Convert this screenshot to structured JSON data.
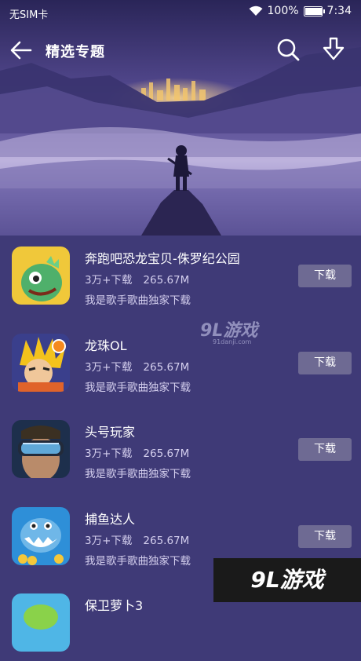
{
  "status_bar": {
    "carrier": "无SIM卡",
    "battery": "100%",
    "battery_level": 1.0,
    "time": "7:34"
  },
  "app_bar": {
    "title": "精选专题"
  },
  "items": [
    {
      "name": "奔跑吧恐龙宝贝-侏罗纪公园",
      "downloads": "3万+下载",
      "size": "265.67M",
      "desc": "我是歌手歌曲独家下载",
      "button": "下载",
      "icon": "dinosaur-game-icon"
    },
    {
      "name": "龙珠OL",
      "downloads": "3万+下载",
      "size": "265.67M",
      "desc": "我是歌手歌曲独家下载",
      "button": "下载",
      "icon": "dragonball-game-icon"
    },
    {
      "name": "头号玩家",
      "downloads": "3万+下载",
      "size": "265.67M",
      "desc": "我是歌手歌曲独家下载",
      "button": "下载",
      "icon": "vr-headset-game-icon"
    },
    {
      "name": "捕鱼达人",
      "downloads": "3万+下载",
      "size": "265.67M",
      "desc": "我是歌手歌曲独家下载",
      "button": "下载",
      "icon": "fish-game-icon"
    },
    {
      "name": "保卫萝卜3",
      "icon": "carrot-game-icon"
    }
  ],
  "watermarks": {
    "center": "9L游戏",
    "center_sub": "91danji.com",
    "corner": "9L游戏"
  },
  "colors": {
    "background": "#3f3a77",
    "button": "#6e6a93",
    "secondary_text": "#d4cfee"
  }
}
